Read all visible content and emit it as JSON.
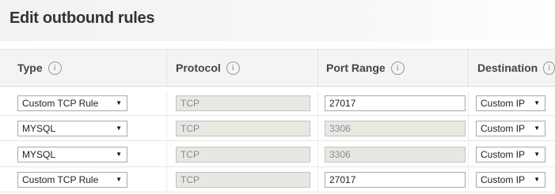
{
  "title": "Edit outbound rules",
  "columns": {
    "type": "Type",
    "protocol": "Protocol",
    "port_range": "Port Range",
    "destination": "Destination"
  },
  "info_glyph": "i",
  "rows": [
    {
      "type": "Custom TCP Rule",
      "protocol": "TCP",
      "port": "27017",
      "port_editable": true,
      "destination": "Custom IP"
    },
    {
      "type": "MYSQL",
      "protocol": "TCP",
      "port": "3306",
      "port_editable": false,
      "destination": "Custom IP"
    },
    {
      "type": "MYSQL",
      "protocol": "TCP",
      "port": "3306",
      "port_editable": false,
      "destination": "Custom IP"
    },
    {
      "type": "Custom TCP Rule",
      "protocol": "TCP",
      "port": "27017",
      "port_editable": true,
      "destination": "Custom IP"
    }
  ],
  "dropdown_arrow": "▼"
}
